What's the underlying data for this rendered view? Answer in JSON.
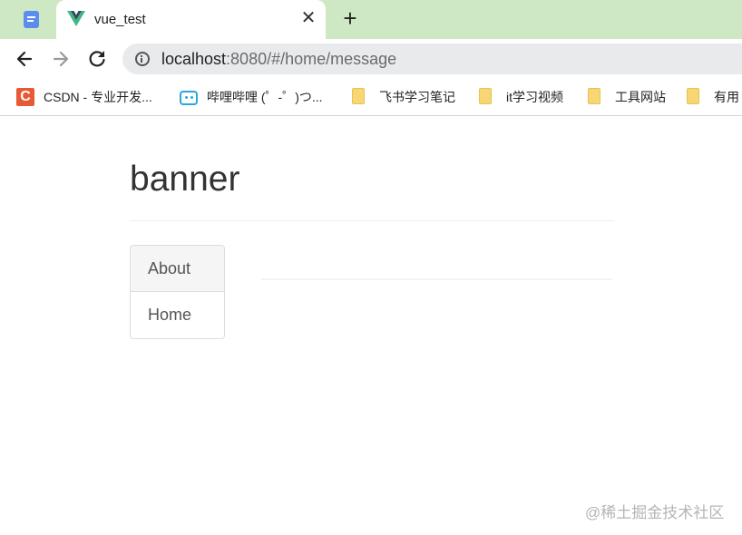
{
  "browser": {
    "tabs": [
      {
        "title": "",
        "icon": "doc-icon",
        "active": false
      },
      {
        "title": "vue_test",
        "icon": "vue-icon",
        "active": true
      }
    ],
    "close_glyph": "✕",
    "new_tab_glyph": "+",
    "url_host": "localhost",
    "url_rest": ":8080/#/home/message",
    "bookmarks": [
      {
        "label": "CSDN - 专业开发...",
        "icon": "csdn-icon"
      },
      {
        "label": "哔哩哔哩 (゜-゜)つ...",
        "icon": "bilibili-icon"
      },
      {
        "label": "飞书学习笔记",
        "icon": "folder-icon"
      },
      {
        "label": "it学习视频",
        "icon": "folder-icon"
      },
      {
        "label": "工具网站",
        "icon": "folder-icon"
      },
      {
        "label": "有用",
        "icon": "folder-icon"
      }
    ]
  },
  "page": {
    "header": "banner",
    "nav": [
      {
        "label": "About",
        "active": true
      },
      {
        "label": "Home",
        "active": false
      }
    ],
    "watermark": "@稀土掘金技术社区"
  },
  "colors": {
    "tabstrip": "#cfe8c4",
    "vue_green": "#41b883",
    "vue_dark": "#35495e"
  }
}
